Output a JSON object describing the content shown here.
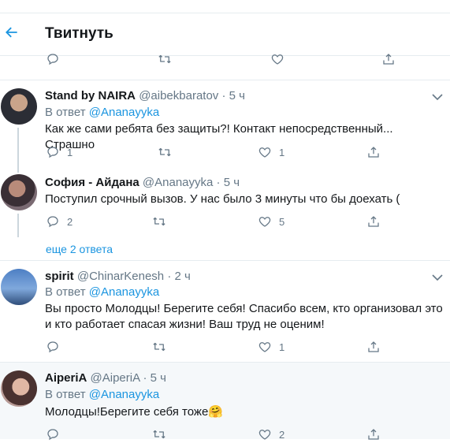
{
  "header": {
    "title": "Твитнуть"
  },
  "top_actions": {
    "reply": "",
    "retweet": "",
    "like": ""
  },
  "tweets": [
    {
      "name": "Stand by NAIRA",
      "handle": "@aibekbaratov",
      "dot": "·",
      "time": "5 ч",
      "reply_prefix": "В ответ",
      "reply_to": "@Ananayyka",
      "text": "Как же сами ребята без защиты?! Контакт непосредственный... Страшно",
      "replies": "1",
      "retweets": "",
      "likes": "1"
    },
    {
      "name": "София - Айдана",
      "handle": "@Ananayyka",
      "dot": "·",
      "time": "5 ч",
      "text": "Поступил срочный вызов. У нас было 3 минуты что бы доехать (",
      "replies": "2",
      "retweets": "",
      "likes": "5"
    },
    {
      "more_replies": "еще 2 ответа"
    },
    {
      "name": "spirit",
      "handle": "@ChinarKenesh",
      "dot": "·",
      "time": "2 ч",
      "reply_prefix": "В ответ",
      "reply_to": "@Ananayyka",
      "text_line1": "Вы просто Молодцы! Берегите себя! Спасибо всем, кто организовал это",
      "text_line2": "и кто работает спасая жизни! Ваш труд не оценим!",
      "replies": "",
      "retweets": "",
      "likes": "1"
    },
    {
      "name": "AiperiA",
      "handle": "@AiperiA",
      "dot": "·",
      "time": "5 ч",
      "reply_prefix": "В ответ",
      "reply_to": "@Ananayyka",
      "text": "Молодцы!Берегите себя тоже",
      "emoji": "🤗",
      "replies": "",
      "retweets": "",
      "likes": "2"
    }
  ],
  "colors": {
    "accent": "#1b95e0",
    "muted": "#657786",
    "border": "#e6ecf0"
  }
}
